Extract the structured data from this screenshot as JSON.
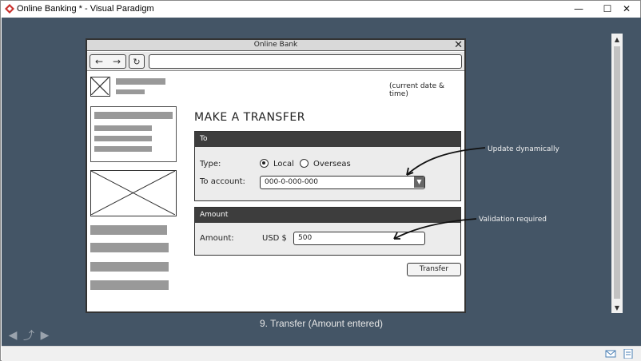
{
  "window": {
    "title": "Online Banking * - Visual Paradigm",
    "min_glyph": "—",
    "max_glyph": "☐",
    "close_glyph": "✕"
  },
  "caption": "9. Transfer (Amount entered)",
  "wireframe": {
    "browser_title": "Online Bank",
    "datetime": "(current date & time)",
    "heading": "MAKE A TRANSFER",
    "to_panel": {
      "title": "To",
      "type_label": "Type:",
      "option_local": "Local",
      "option_overseas": "Overseas",
      "selected_type": "Local",
      "account_label": "To account:",
      "account_value": "000-0-000-000"
    },
    "amount_panel": {
      "title": "Amount",
      "amount_label": "Amount:",
      "currency": "USD $",
      "amount_value": "500"
    },
    "transfer_button": "Transfer"
  },
  "annotations": {
    "update_note": "Update dynamically",
    "validation_note": "Validation required"
  },
  "icons": [
    "app-logo-icon",
    "back-icon",
    "forward-icon",
    "reload-icon",
    "close-icon",
    "dropdown-arrow-icon",
    "mail-icon",
    "note-icon"
  ],
  "colors": {
    "canvas": "#445566",
    "panel_header": "#3d3d3d",
    "placeholder_bar": "#999999"
  }
}
